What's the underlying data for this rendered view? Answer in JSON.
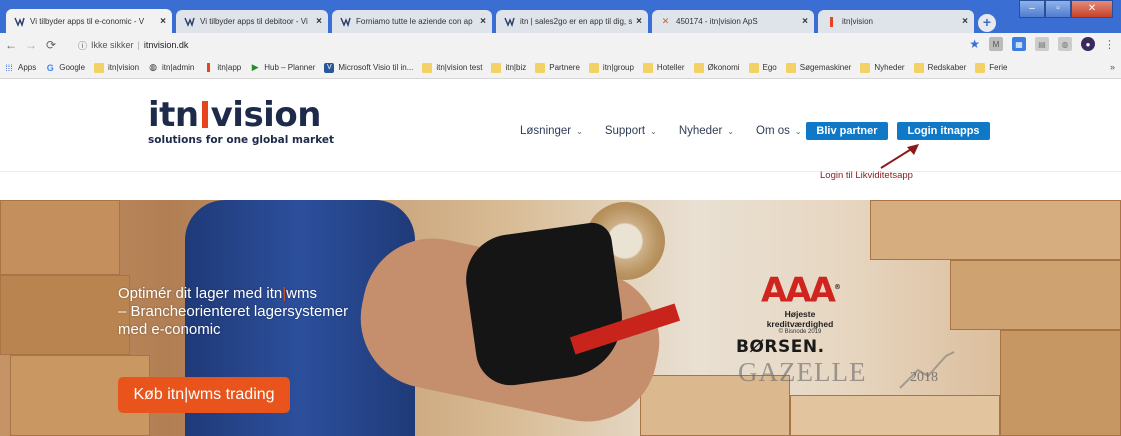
{
  "tabs": [
    {
      "title": "Vi tilbyder apps til e-conomic - V",
      "active": true
    },
    {
      "title": "Vi tilbyder apps til debitoor - Vi",
      "active": false
    },
    {
      "title": "Forniamo tutte le aziende con ap",
      "active": false
    },
    {
      "title": "itn | sales2go er en app til dig, sc",
      "active": false
    },
    {
      "title": "450174 - itn|vision ApS",
      "active": false
    },
    {
      "title": "itn|vision",
      "active": false
    }
  ],
  "address_bar": {
    "security_text": "Ikke sikker",
    "url": "itnvision.dk"
  },
  "bookmarks": [
    {
      "label": "Apps",
      "icon": "apps-grid-icon"
    },
    {
      "label": "Google",
      "icon": "google-icon"
    },
    {
      "label": "itn|vision",
      "icon": "folder-icon"
    },
    {
      "label": "itn|admin",
      "icon": "globe-icon"
    },
    {
      "label": "itn|app",
      "icon": "itn-icon"
    },
    {
      "label": "Hub – Planner",
      "icon": "hub-planner-icon"
    },
    {
      "label": "Microsoft Visio til in...",
      "icon": "visio-icon"
    },
    {
      "label": "itn|vision test",
      "icon": "folder-icon"
    },
    {
      "label": "itn|biz",
      "icon": "folder-icon"
    },
    {
      "label": "Partnere",
      "icon": "folder-icon"
    },
    {
      "label": "itn|group",
      "icon": "folder-icon"
    },
    {
      "label": "Hoteller",
      "icon": "folder-icon"
    },
    {
      "label": "Økonomi",
      "icon": "folder-icon"
    },
    {
      "label": "Ego",
      "icon": "folder-icon"
    },
    {
      "label": "Søgemaskiner",
      "icon": "folder-icon"
    },
    {
      "label": "Nyheder",
      "icon": "folder-icon"
    },
    {
      "label": "Redskaber",
      "icon": "folder-icon"
    },
    {
      "label": "Ferie",
      "icon": "folder-icon"
    }
  ],
  "bookmarks_more": "»",
  "site": {
    "logo_left": "itn",
    "logo_right": "vision",
    "tagline": "solutions for one global market",
    "nav": [
      {
        "label": "Løsninger"
      },
      {
        "label": "Support"
      },
      {
        "label": "Nyheder"
      },
      {
        "label": "Om os"
      }
    ],
    "partner_button": "Bliv partner",
    "login_button": "Login itnapps",
    "annotation": "Login til Likviditetsapp"
  },
  "hero": {
    "line1_pre": "Optimér dit lager med itn",
    "line1_bar": "|",
    "line1_post": "wms",
    "line2": "– Brancheorienteret lagersystemer",
    "line3": "med e-conomic",
    "cta_pre": "Køb itn",
    "cta_bar": "|",
    "cta_post": "wms trading",
    "aaa": "AAA",
    "aaa_registered": "®",
    "aaa_sub": "Højeste kreditværdighed",
    "aaa_source": "© Bisnode 2019",
    "borsen": "BØRSEN.",
    "gazelle": "GAZELLE",
    "gazelle_year": "2018"
  },
  "colors": {
    "chrome_blue": "#3a6ed3",
    "brand_navy": "#1d2a4a",
    "brand_orange": "#e8541b",
    "button_blue": "#0f79c8",
    "annotation_red": "#8b1a1a"
  }
}
